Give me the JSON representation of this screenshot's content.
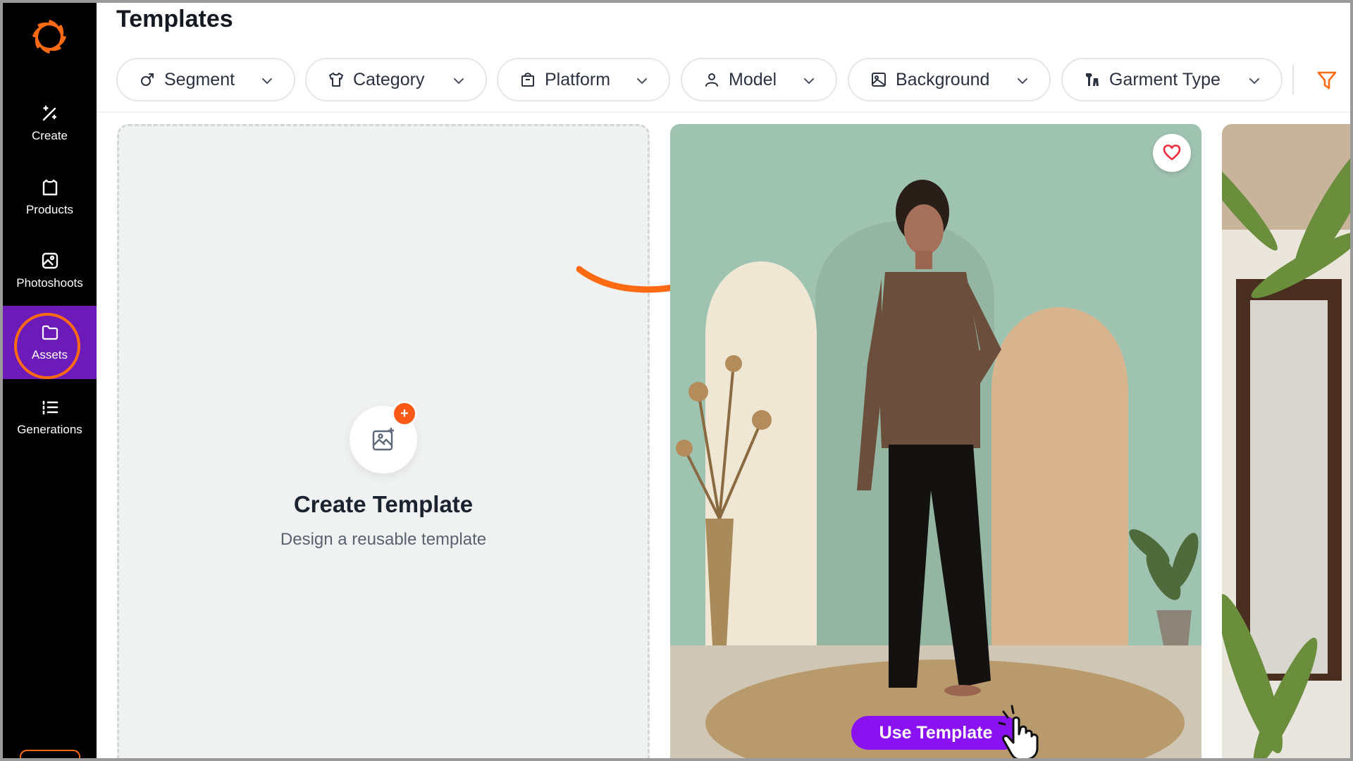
{
  "page": {
    "title": "Templates"
  },
  "sidebar": {
    "items": [
      {
        "label": "Create",
        "icon": "magic-wand-icon"
      },
      {
        "label": "Products",
        "icon": "shirt-icon"
      },
      {
        "label": "Photoshoots",
        "icon": "image-gallery-icon"
      },
      {
        "label": "Assets",
        "icon": "folder-icon",
        "active": true
      },
      {
        "label": "Generations",
        "icon": "list-icon"
      }
    ],
    "active_color": "#6d1bb8",
    "highlight_color": "#ff6a13"
  },
  "filters": [
    {
      "label": "Segment",
      "icon": "gender-icon"
    },
    {
      "label": "Category",
      "icon": "shirt-icon"
    },
    {
      "label": "Platform",
      "icon": "shopping-bag-icon"
    },
    {
      "label": "Model",
      "icon": "person-icon"
    },
    {
      "label": "Background",
      "icon": "image-icon"
    },
    {
      "label": "Garment Type",
      "icon": "garment-icon"
    }
  ],
  "create_card": {
    "title": "Create Template",
    "subtitle": "Design a reusable template",
    "badge": "+"
  },
  "template_card": {
    "button_label": "Use Template",
    "button_color": "#8a12f0",
    "favorite_icon": "heart-icon"
  },
  "colors": {
    "accent": "#fa5a15",
    "arrow": "#ff6a13"
  }
}
